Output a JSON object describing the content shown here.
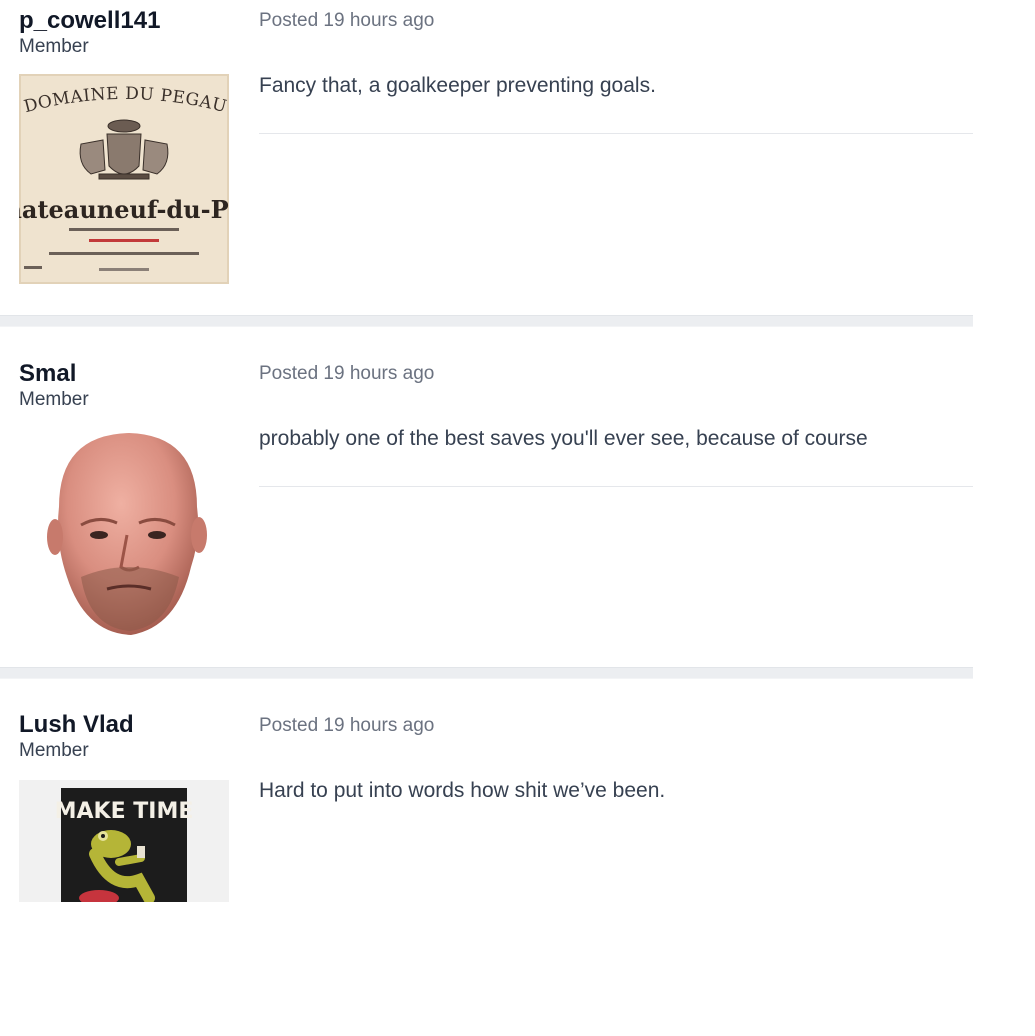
{
  "posts": [
    {
      "author": "p_cowell141",
      "role": "Member",
      "avatar": {
        "kind": "wine-label",
        "line1": "DOMAINE DU PEGAU",
        "line2": "hateauneuf-du-Pa",
        "colors": {
          "paper": "#efe3cf",
          "ink": "#3a302a",
          "red": "#c23a3a"
        }
      },
      "posted": "Posted 19 hours ago",
      "text": "Fancy that, a goalkeeper preventing goals."
    },
    {
      "author": "Smal",
      "role": "Member",
      "avatar": {
        "kind": "face-photo",
        "colors": {
          "skin": "#d98e80",
          "shadow": "#9c5447",
          "beard": "#8a5a48"
        }
      },
      "posted": "Posted 19 hours ago",
      "text": "probably one of the best saves you'll ever see, because of course"
    },
    {
      "author": "Lush Vlad",
      "role": "Member",
      "avatar": {
        "kind": "poster",
        "line1": "MAKE TIME",
        "colors": {
          "bg": "#f1f1f1",
          "poster": "#1c1c1c",
          "frog": "#b5b537",
          "stool": "#c6343d"
        }
      },
      "posted": "Posted 19 hours ago",
      "text": "Hard to put into words how shit we’ve been."
    }
  ],
  "colors": {
    "separator": "#eceef1",
    "rule": "#e5e7eb",
    "meta": "#6b7280",
    "name": "#111827"
  }
}
